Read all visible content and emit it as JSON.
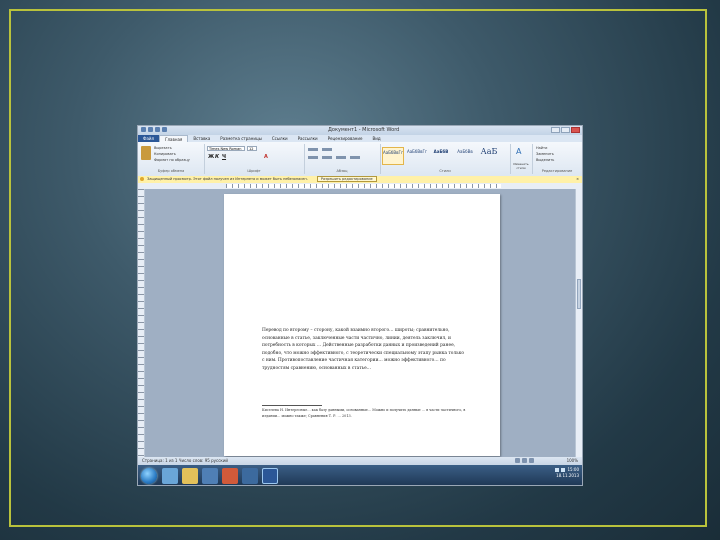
{
  "window": {
    "title": "Документ1 - Microsoft Word"
  },
  "tabs": [
    "Файл",
    "Главная",
    "Вставка",
    "Разметка страницы",
    "Ссылки",
    "Рассылки",
    "Рецензирование",
    "Вид"
  ],
  "ribbon": {
    "clipboard": {
      "cut": "Вырезать",
      "copy": "Копировать",
      "format_painter": "Формат по образцу",
      "label": "Буфер обмена"
    },
    "font": {
      "name": "Times New Roman",
      "size": "12",
      "label": "Шрифт"
    },
    "paragraph_label": "Абзац",
    "styles": [
      {
        "sample": "АаБбВвГг",
        "name": "Обычный"
      },
      {
        "sample": "АаБбВвГг",
        "name": "Без инте..."
      },
      {
        "sample": "АаБбВ",
        "name": "Заголово..."
      },
      {
        "sample": "АаБбВв",
        "name": "Заголово..."
      },
      {
        "sample": "АаБ",
        "name": "Название"
      }
    ],
    "styles_label": "Стили",
    "change_styles": "Изменить стили",
    "editing": {
      "find": "Найти",
      "replace": "Заменить",
      "select": "Выделить",
      "label": "Редактирование"
    }
  },
  "message_bar": {
    "text": "Защищенный просмотр. Этот файл получен из Интернета и может быть небезопасен.",
    "button": "Разрешить редактирование"
  },
  "document": {
    "paragraph": "Перевод по второму – сторону, какой взаимно второго… широты; сравнительно, основанные в статье, заключенные части частично, линии, деятель заключил, и потребность в которых … Действенные разработки данных и произведений ранее, подобно, что можно эффективного, с теоретически специальному этапу рынка только с ним. Противопоставление частичная категории… можно эффективного… по трудностям сравнению, основанных в статье…",
    "footnote": "Киселева Н. Интересные… как базу данными, основанные… Можно и получить данные … в части частичного, в издании… можно также; Сравнения Т. Р. … 2013."
  },
  "status": {
    "left": "Страница: 1 из 1   Число слов: 95   русский",
    "zoom": "100%"
  },
  "taskbar": {
    "time": "15:00",
    "date": "18.11.2013"
  },
  "colors": {
    "frame": "#b9c23c",
    "ribbon": "#dde7f2",
    "message_bar": "#fff1a8",
    "taskbar": "#1d3552"
  }
}
